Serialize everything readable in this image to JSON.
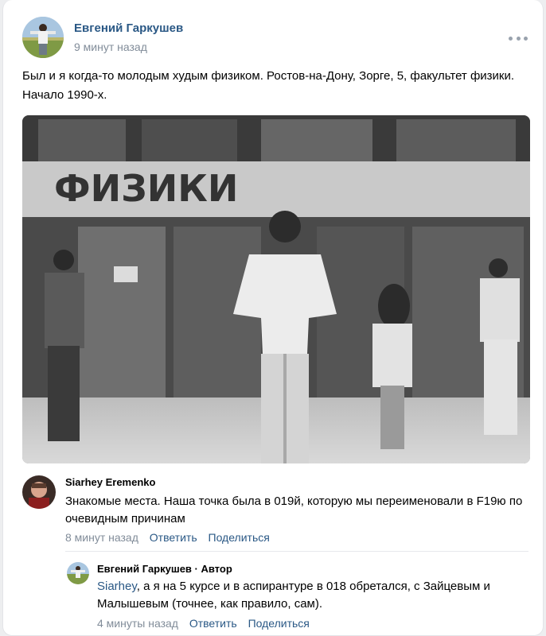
{
  "post": {
    "author": "Евгений Гаркушев",
    "time": "9 минут назад",
    "text": "Был и я когда-то молодым худым физиком. Ростов-на-Дону, Зорге, 5, факультет физики. Начало 1990-х.",
    "photo_sign": "ФИЗИКИ",
    "more_icon": "more-horizontal-icon"
  },
  "comments": [
    {
      "author": "Siarhey Eremenko",
      "text": "Знакомые места. Наша точка была в 019й, которую мы переименовали в F19ю по очевидным причинам",
      "time": "8 минут назад",
      "reply_label": "Ответить",
      "share_label": "Поделиться"
    },
    {
      "author": "Евгений Гаркушев · Автор",
      "mention": "Siarhey",
      "text": ", а я на 5 курсе и в аспирантуре в 018 обретался, с Зайцевым и Малышевым (точнее, как правило, сам).",
      "time": "4 минуты назад",
      "reply_label": "Ответить",
      "share_label": "Поделиться"
    }
  ],
  "colors": {
    "link": "#2a5885",
    "secondary": "#818c99",
    "divider": "#e7e8ec"
  }
}
